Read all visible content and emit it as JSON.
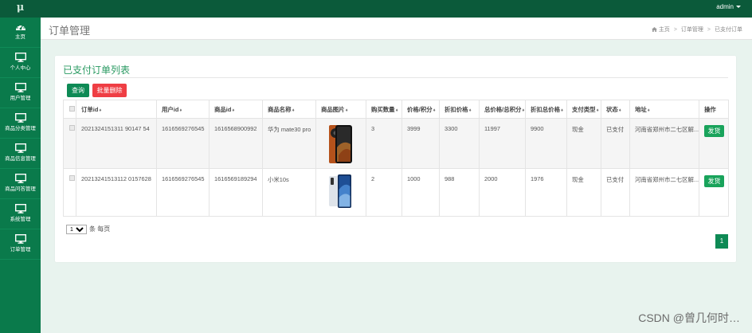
{
  "app": {
    "logo": "μ",
    "user": "admin"
  },
  "sidebar": {
    "items": [
      {
        "label": "主页",
        "icon": "dashboard-icon"
      },
      {
        "label": "个人中心",
        "icon": "monitor-icon"
      },
      {
        "label": "用户管理",
        "icon": "monitor-icon"
      },
      {
        "label": "商品分类管理",
        "icon": "monitor-icon"
      },
      {
        "label": "商品信息管理",
        "icon": "monitor-icon"
      },
      {
        "label": "商品问答管理",
        "icon": "monitor-icon"
      },
      {
        "label": "系统管理",
        "icon": "monitor-icon"
      },
      {
        "label": "订单管理",
        "icon": "monitor-icon"
      }
    ]
  },
  "header": {
    "title": "订单管理",
    "breadcrumb": [
      "主页",
      "订单管理",
      "已支付订单"
    ]
  },
  "panel": {
    "title": "已支付订单列表",
    "query_label": "查询",
    "batch_delete_label": "批量删除"
  },
  "table": {
    "columns": [
      "订单id",
      "用户id",
      "商品id",
      "商品名称",
      "商品图片",
      "购买数量",
      "价格/积分",
      "折扣价格",
      "总价格/总积分",
      "折扣总价格",
      "支付类型",
      "状态",
      "地址",
      "操作"
    ],
    "sort_mark": "♦",
    "rows": [
      {
        "order_id": "2021324151311 90147 54",
        "user_id": "1616569276545",
        "product_id": "1616568900992",
        "name": "华为 mate30 pro",
        "qty": "3",
        "price": "3999",
        "discount_price": "3300",
        "total": "11997",
        "discount_total": "9900",
        "pay_type": "现金",
        "status": "已支付",
        "address": "河南省郑州市二七区解...",
        "action": "发货"
      },
      {
        "order_id": "20213241513112 0157628",
        "user_id": "1616569276545",
        "product_id": "1616569189294",
        "name": "小米10s",
        "qty": "2",
        "price": "1000",
        "discount_price": "988",
        "total": "2000",
        "discount_total": "1976",
        "pay_type": "现金",
        "status": "已支付",
        "address": "河南省郑州市二七区解...",
        "action": "发货"
      }
    ]
  },
  "pagination": {
    "per_page": "10",
    "per_page_suffix": "条 每页",
    "current_page": "1"
  },
  "watermark": "CSDN @曾几何时…",
  "colors": {
    "topbar": "#0b5a3a",
    "sidebar": "#0a7a4b",
    "accent": "#2a9a62",
    "danger": "#ef3e44",
    "ship": "#19a35b"
  }
}
